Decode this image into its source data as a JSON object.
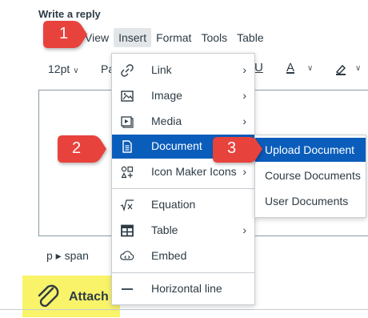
{
  "heading": "Write a reply",
  "menubar": {
    "view": "View",
    "insert": "Insert",
    "format": "Format",
    "tools": "Tools",
    "table": "Table"
  },
  "toolbar": {
    "font_size": "12pt",
    "paragraph": "Pa",
    "underline": "U",
    "text_color": "A",
    "highlight_icon": "highlighter-icon"
  },
  "insert_menu": {
    "items": [
      {
        "label": "Link",
        "icon": "link-icon",
        "has_submenu": true
      },
      {
        "label": "Image",
        "icon": "image-icon",
        "has_submenu": true
      },
      {
        "label": "Media",
        "icon": "media-icon",
        "has_submenu": true
      },
      {
        "label": "Document",
        "icon": "document-icon",
        "has_submenu": false,
        "selected": true
      },
      {
        "label": "Icon Maker Icons",
        "icon": "icon-maker-icon",
        "has_submenu": true
      },
      {
        "label": "Equation",
        "icon": "equation-icon",
        "has_submenu": false
      },
      {
        "label": "Table",
        "icon": "table-icon",
        "has_submenu": true
      },
      {
        "label": "Embed",
        "icon": "embed-icon",
        "has_submenu": false
      },
      {
        "label": "Horizontal line",
        "icon": "horizontal-line-icon",
        "has_submenu": false
      }
    ]
  },
  "document_submenu": {
    "items": [
      {
        "label": "Upload Document",
        "selected": true
      },
      {
        "label": "Course Documents"
      },
      {
        "label": "User Documents"
      }
    ]
  },
  "status_path": "p ▸ span",
  "attach": {
    "label": "Attach",
    "icon": "paperclip-icon"
  },
  "callouts": [
    "1",
    "2",
    "3"
  ],
  "colors": {
    "callout_red": "#e8423d",
    "selected_blue": "#0b5dbb",
    "highlight_yellow": "#f9f36a"
  }
}
